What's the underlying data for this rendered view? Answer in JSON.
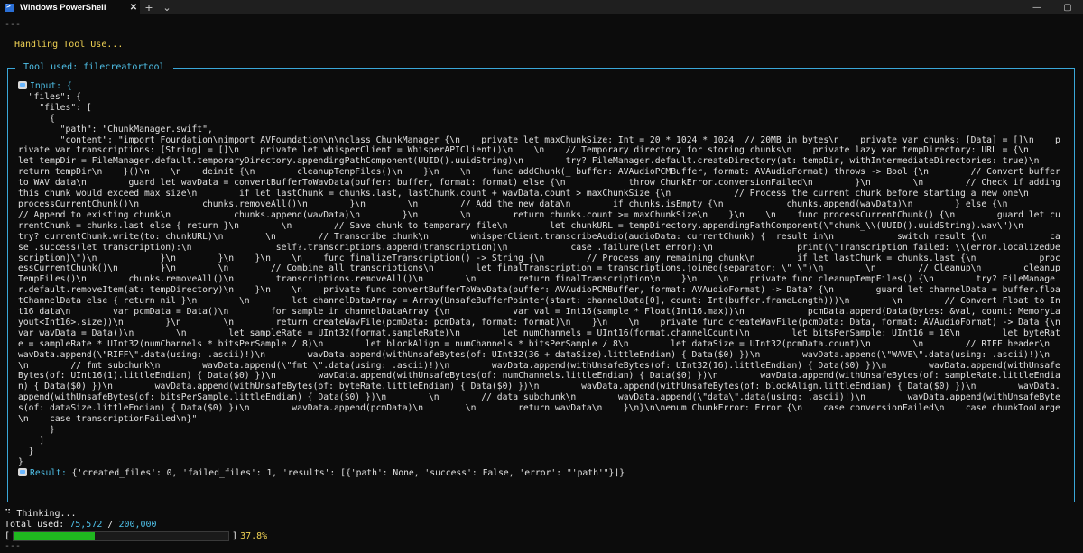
{
  "window": {
    "tab_title": "Windows PowerShell",
    "tab_close": "✕",
    "new_tab": "+",
    "dropdown": "⌄",
    "minimize": "—",
    "maximize": "▢"
  },
  "terminal": {
    "sep_top": "---",
    "handling": "Handling Tool Use...",
    "tool_used_title": " Tool used: filecreatortool ",
    "input_label": "Input: {",
    "json_lines": [
      "  \"files\": {",
      "    \"files\": [",
      "      {",
      "        \"path\": \"ChunkManager.swift\","
    ],
    "content_key": "        \"content\": ",
    "content_text": "\"import Foundation\\nimport AVFoundation\\n\\nclass ChunkManager {\\n    private let maxChunkSize: Int = 20 * 1024 * 1024  // 20MB in bytes\\n    private var chunks: [Data] = []\\n    private var transcriptions: [String] = []\\n    private let whisperClient = WhisperAPIClient()\\n    \\n    // Temporary directory for storing chunks\\n    private lazy var tempDirectory: URL = {\\n        let tempDir = FileManager.default.temporaryDirectory.appendingPathComponent(UUID().uuidString)\\n        try? FileManager.default.createDirectory(at: tempDir, withIntermediateDirectories: true)\\n        return tempDir\\n    }()\\n    \\n    deinit {\\n        cleanupTempFiles()\\n    }\\n    \\n    func addChunk(_ buffer: AVAudioPCMBuffer, format: AVAudioFormat) throws -> Bool {\\n        // Convert buffer to WAV data\\n        guard let wavData = convertBufferToWavData(buffer: buffer, format: format) else {\\n            throw ChunkError.conversionFailed\\n        }\\n        \\n        // Check if adding this chunk would exceed max size\\n        if let lastChunk = chunks.last, lastChunk.count + wavData.count > maxChunkSize {\\n            // Process the current chunk before starting a new one\\n            processCurrentChunk()\\n            chunks.removeAll()\\n        }\\n        \\n        // Add the new data\\n        if chunks.isEmpty {\\n            chunks.append(wavData)\\n        } else {\\n            // Append to existing chunk\\n            chunks.append(wavData)\\n        }\\n        \\n        return chunks.count >= maxChunkSize\\n    }\\n    \\n    func processCurrentChunk() {\\n        guard let currentChunk = chunks.last else { return }\\n        \\n        // Save chunk to temporary file\\n        let chunkURL = tempDirectory.appendingPathComponent(\\\"chunk_\\\\(UUID().uuidString).wav\\\")\\n        try? currentChunk.write(to: chunkURL)\\n        \\n        // Transcribe chunk\\n        whisperClient.transcribeAudio(audioData: currentChunk) {  result in\\n            switch result {\\n            case .success(let transcription):\\n                self?.transcriptions.append(transcription)\\n            case .failure(let error):\\n                print(\\\"Transcription failed: \\\\(error.localizedDescription)\\\")\\n            }\\n        }\\n    }\\n    \\n    func finalizeTranscription() -> String {\\n        // Process any remaining chunk\\n        if let lastChunk = chunks.last {\\n            processCurrentChunk()\\n        }\\n        \\n        // Combine all transcriptions\\n        let finalTranscription = transcriptions.joined(separator: \\\" \\\")\\n        \\n        // Cleanup\\n        cleanupTempFiles()\\n        chunks.removeAll()\\n        transcriptions.removeAll()\\n        \\n        return finalTranscription\\n    }\\n    \\n    private func cleanupTempFiles() {\\n        try? FileManager.default.removeItem(at: tempDirectory)\\n    }\\n    \\n    private func convertBufferToWavData(buffer: AVAudioPCMBuffer, format: AVAudioFormat) -> Data? {\\n        guard let channelData = buffer.floatChannelData else { return nil }\\n        \\n        let channelDataArray = Array(UnsafeBufferPointer(start: channelData[0], count: Int(buffer.frameLength)))\\n        \\n        // Convert Float to Int16 data\\n        var pcmData = Data()\\n        for sample in channelDataArray {\\n            var val = Int16(sample * Float(Int16.max))\\n            pcmData.append(Data(bytes: &val, count: MemoryLayout<Int16>.size))\\n        }\\n        \\n        return createWavFile(pcmData: pcmData, format: format)\\n    }\\n    \\n    private func createWavFile(pcmData: Data, format: AVAudioFormat) -> Data {\\n        var wavData = Data()\\n        \\n        let sampleRate = UInt32(format.sampleRate)\\n        let numChannels = UInt16(format.channelCount)\\n        let bitsPerSample: UInt16 = 16\\n        let byteRate = sampleRate * UInt32(numChannels * bitsPerSample / 8)\\n        let blockAlign = numChannels * bitsPerSample / 8\\n        let dataSize = UInt32(pcmData.count)\\n        \\n        // RIFF header\\n        wavData.append(\\\"RIFF\\\".data(using: .ascii)!)\\n        wavData.append(withUnsafeBytes(of: UInt32(36 + dataSize).littleEndian) { Data($0) })\\n        wavData.append(\\\"WAVE\\\".data(using: .ascii)!)\\n        \\n        // fmt subchunk\\n        wavData.append(\\\"fmt \\\".data(using: .ascii)!)\\n        wavData.append(withUnsafeBytes(of: UInt32(16).littleEndian) { Data($0) })\\n        wavData.append(withUnsafeBytes(of: UInt16(1).littleEndian) { Data($0) })\\n        wavData.append(withUnsafeBytes(of: numChannels.littleEndian) { Data($0) })\\n        wavData.append(withUnsafeBytes(of: sampleRate.littleEndian) { Data($0) })\\n        wavData.append(withUnsafeBytes(of: byteRate.littleEndian) { Data($0) })\\n        wavData.append(withUnsafeBytes(of: blockAlign.littleEndian) { Data($0) })\\n        wavData.append(withUnsafeBytes(of: bitsPerSample.littleEndian) { Data($0) })\\n        \\n        // data subchunk\\n        wavData.append(\\\"data\\\".data(using: .ascii)!)\\n        wavData.append(withUnsafeBytes(of: dataSize.littleEndian) { Data($0) })\\n        wavData.append(pcmData)\\n        \\n        return wavData\\n    }\\n}\\n\\nenum ChunkError: Error {\\n    case conversionFailed\\n    case chunkTooLarge\\n    case transcriptionFailed\\n}\"",
    "json_close_lines": [
      "      }",
      "    ]",
      "  }",
      "}"
    ],
    "result_label": "Result:",
    "result_text": " {'created_files': 0, 'failed_files': 1, 'results': [{'path': None, 'success': False, 'error': \"'path'\"}]}",
    "thinking": "⠙ Thinking...",
    "total_label": "Total used: ",
    "total_used": "75,572",
    "total_sep": " / ",
    "total_max": "200,000",
    "bar_open": "[",
    "bar_close": "]",
    "progress_fraction": 0.378,
    "progress_pct": "37.8%",
    "sep_bottom": "---"
  }
}
